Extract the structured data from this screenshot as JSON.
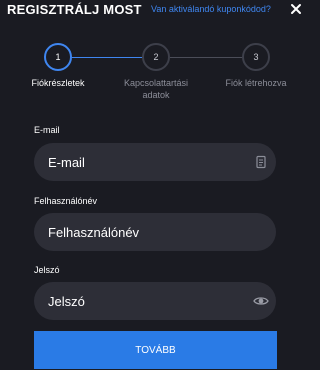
{
  "header": {
    "title": "REGISZTRÁLJ MOST",
    "coupon_link": "Van aktiválandó kuponkódod?",
    "close_icon": "close-icon"
  },
  "stepper": {
    "steps": [
      {
        "number": "1",
        "label": "Fiókrészletek",
        "active": true
      },
      {
        "number": "2",
        "label": "Kapcsolattartási adatok",
        "active": false
      },
      {
        "number": "3",
        "label": "Fiók létrehozva",
        "active": false
      }
    ]
  },
  "form": {
    "email": {
      "label": "E-mail",
      "placeholder": "E-mail",
      "icon": "id-card-icon"
    },
    "username": {
      "label": "Felhasználónév",
      "placeholder": "Felhasználónév"
    },
    "password": {
      "label": "Jelszó",
      "placeholder": "Jelszó",
      "icon": "eye-icon"
    },
    "submit_label": "TOVÁBB"
  },
  "colors": {
    "background": "#1a1b22",
    "field": "#2d2e37",
    "accent": "#3f86f0",
    "button": "#2a7be6"
  }
}
